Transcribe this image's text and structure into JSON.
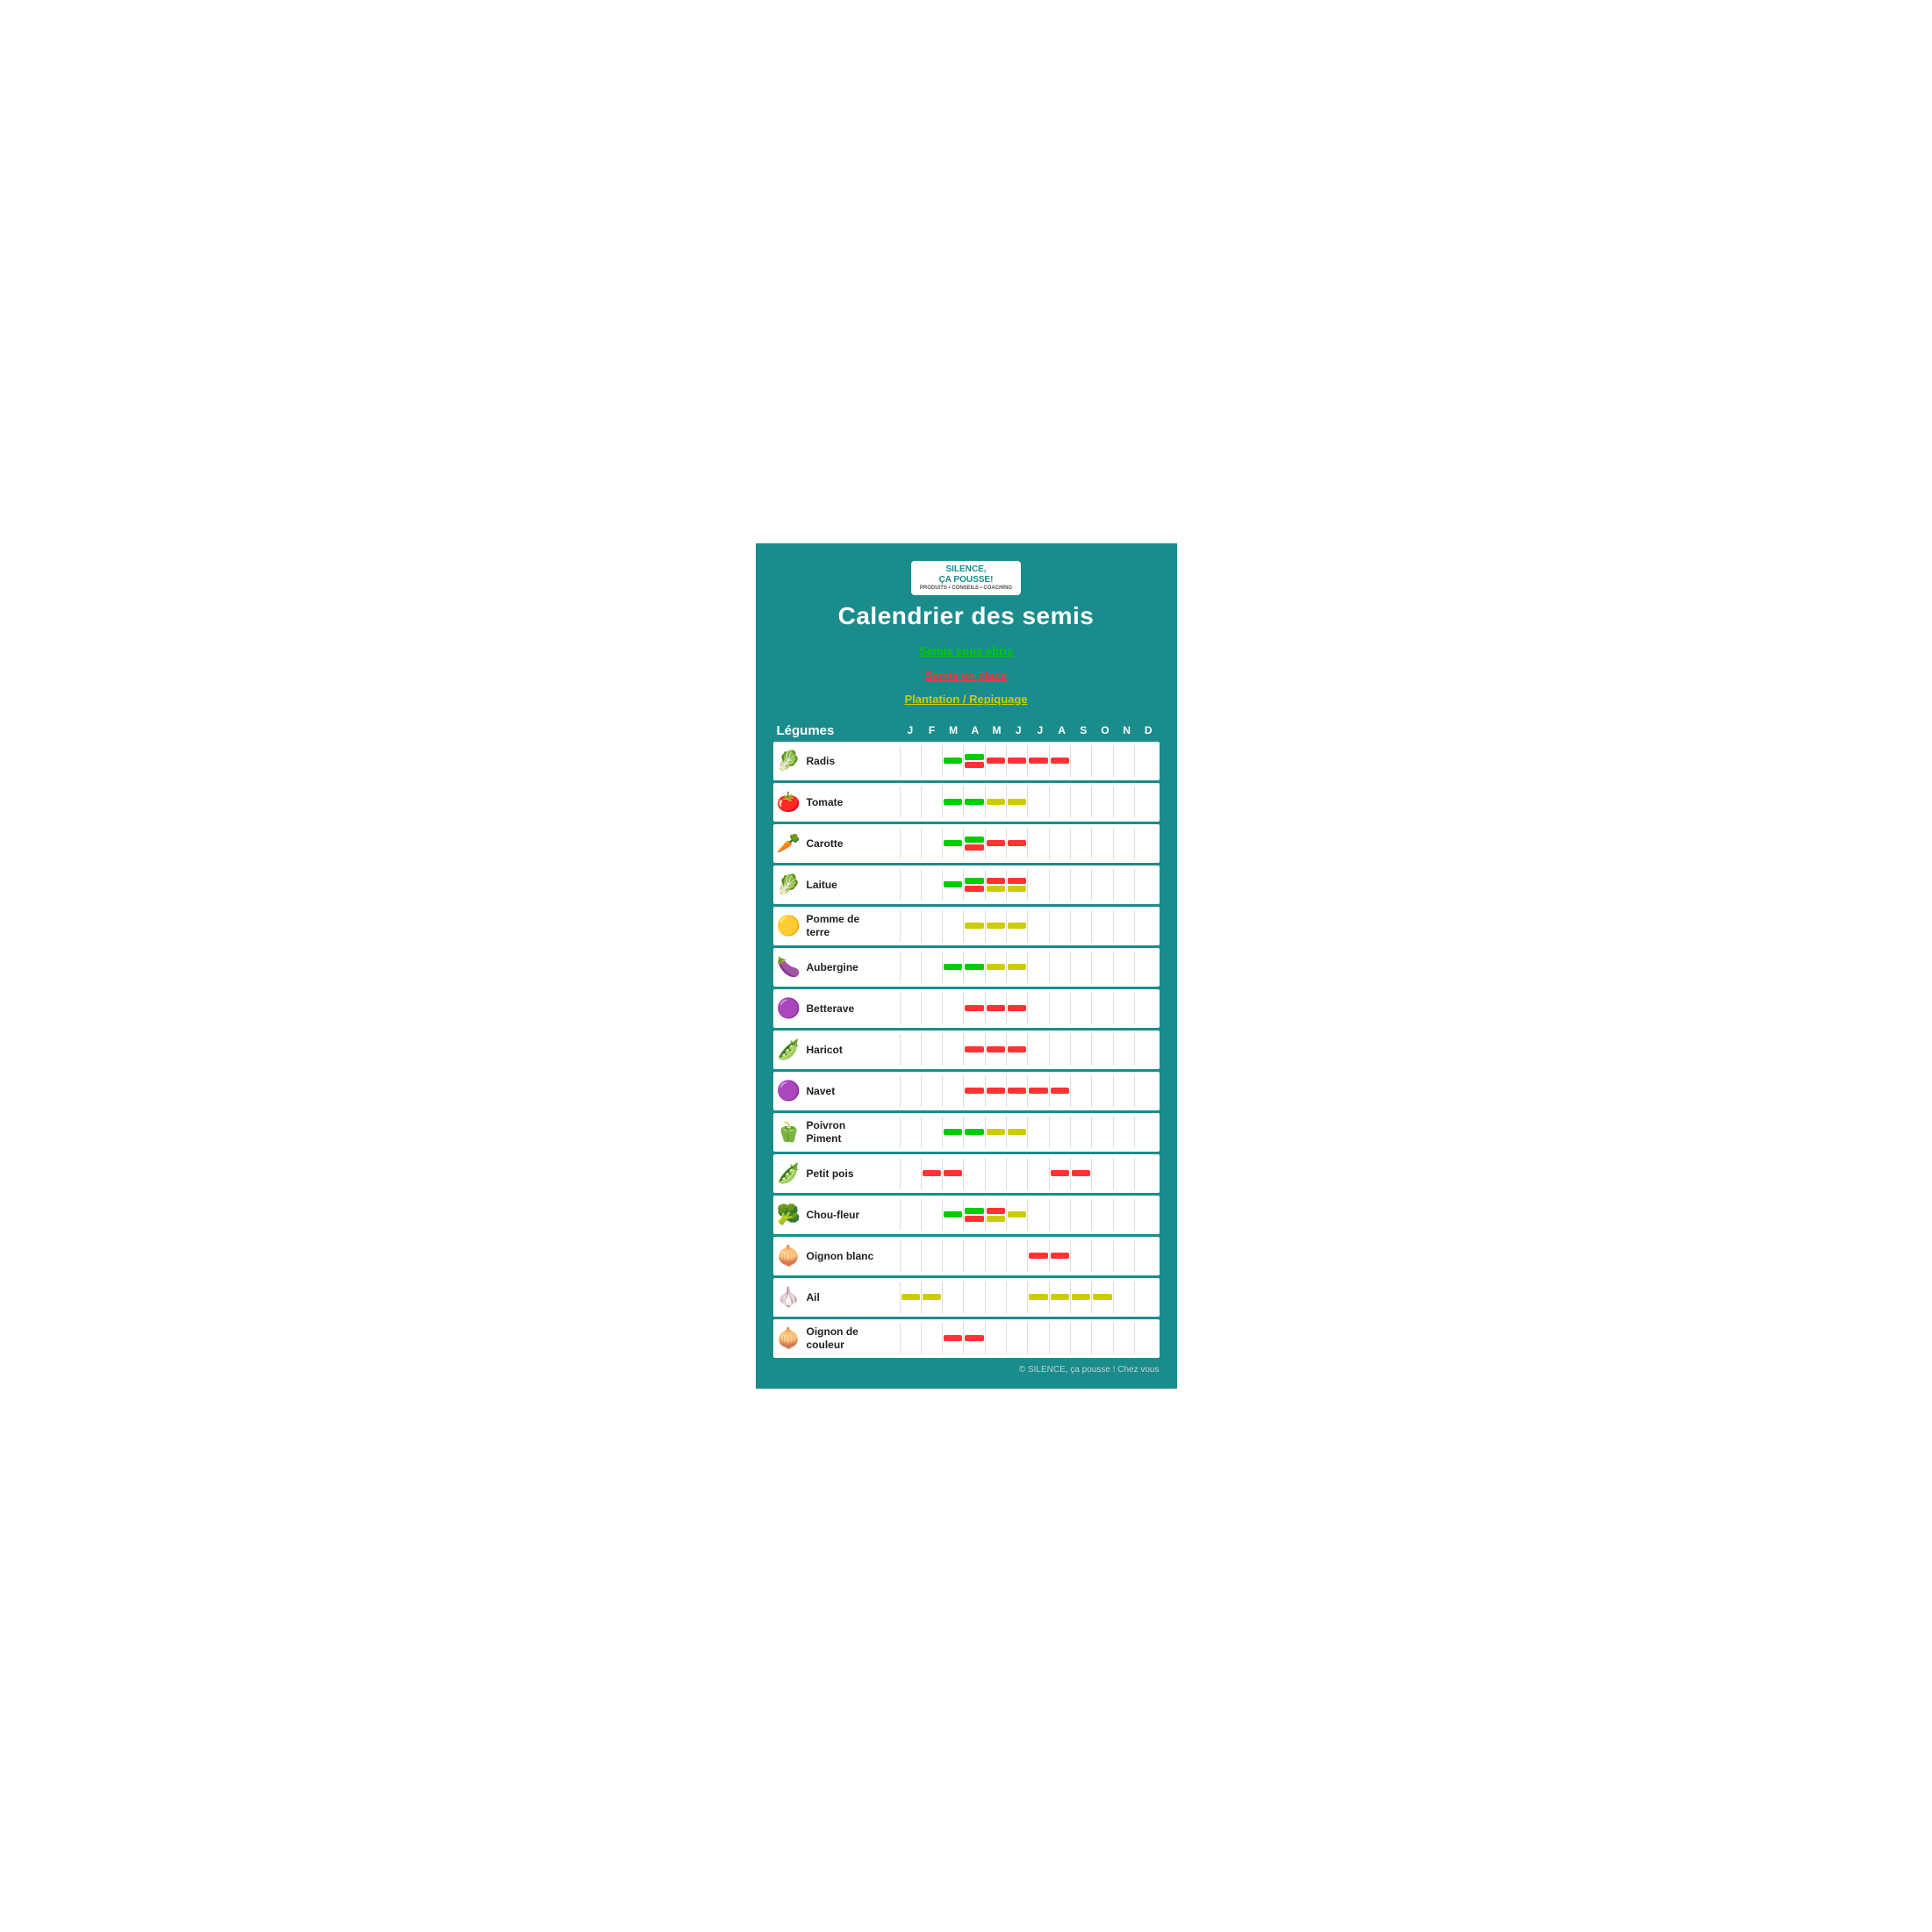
{
  "logo": {
    "line1": "SILENCE,",
    "line2": "ça pousse!",
    "sub": "PRODUITS • CONSEILS • COACHING"
  },
  "title": "Calendrier des semis",
  "legend": [
    {
      "label": "Semis sous abris",
      "color": "green"
    },
    {
      "label": "Semis en place",
      "color": "red"
    },
    {
      "label": "Plantation / Repiquage",
      "color": "yellow"
    }
  ],
  "months": [
    "J",
    "F",
    "M",
    "A",
    "M",
    "J",
    "J",
    "A",
    "S",
    "O",
    "N",
    "D"
  ],
  "col_header": "Légumes",
  "footer": "© SILENCE, ça pousse ! Chez vous",
  "vegetables": [
    {
      "name": "Radis",
      "icon": "🥬",
      "bars": [
        {
          "month": 2,
          "types": [
            "green"
          ]
        },
        {
          "month": 3,
          "types": [
            "green",
            "red"
          ]
        },
        {
          "month": 4,
          "types": [
            "red"
          ]
        },
        {
          "month": 5,
          "types": [
            "red"
          ]
        },
        {
          "month": 6,
          "types": [
            "red"
          ]
        },
        {
          "month": 7,
          "types": [
            "red"
          ]
        }
      ]
    },
    {
      "name": "Tomate",
      "icon": "🍅",
      "bars": [
        {
          "month": 2,
          "types": [
            "green"
          ]
        },
        {
          "month": 3,
          "types": [
            "green"
          ]
        },
        {
          "month": 4,
          "types": [
            "yellow"
          ]
        },
        {
          "month": 5,
          "types": [
            "yellow"
          ]
        }
      ]
    },
    {
      "name": "Carotte",
      "icon": "🥕",
      "bars": [
        {
          "month": 2,
          "types": [
            "green"
          ]
        },
        {
          "month": 3,
          "types": [
            "green",
            "red"
          ]
        },
        {
          "month": 4,
          "types": [
            "red"
          ]
        },
        {
          "month": 5,
          "types": [
            "red"
          ]
        }
      ]
    },
    {
      "name": "Laitue",
      "icon": "🥬",
      "bars": [
        {
          "month": 2,
          "types": [
            "green"
          ]
        },
        {
          "month": 3,
          "types": [
            "green",
            "red"
          ]
        },
        {
          "month": 4,
          "types": [
            "red",
            "yellow"
          ]
        },
        {
          "month": 5,
          "types": [
            "red",
            "yellow"
          ]
        }
      ]
    },
    {
      "name": "Pomme de\nterre",
      "icon": "🟡",
      "bars": [
        {
          "month": 3,
          "types": [
            "yellow"
          ]
        },
        {
          "month": 4,
          "types": [
            "yellow"
          ]
        },
        {
          "month": 5,
          "types": [
            "yellow"
          ]
        }
      ]
    },
    {
      "name": "Aubergine",
      "icon": "🍆",
      "bars": [
        {
          "month": 2,
          "types": [
            "green"
          ]
        },
        {
          "month": 3,
          "types": [
            "green"
          ]
        },
        {
          "month": 4,
          "types": [
            "yellow"
          ]
        },
        {
          "month": 5,
          "types": [
            "yellow"
          ]
        }
      ]
    },
    {
      "name": "Betterave",
      "icon": "🟣",
      "bars": [
        {
          "month": 3,
          "types": [
            "red"
          ]
        },
        {
          "month": 4,
          "types": [
            "red"
          ]
        },
        {
          "month": 5,
          "types": [
            "red"
          ]
        }
      ]
    },
    {
      "name": "Haricot",
      "icon": "🫛",
      "bars": [
        {
          "month": 3,
          "types": [
            "red"
          ]
        },
        {
          "month": 4,
          "types": [
            "red"
          ]
        },
        {
          "month": 5,
          "types": [
            "red"
          ]
        }
      ]
    },
    {
      "name": "Navet",
      "icon": "🟣",
      "bars": [
        {
          "month": 3,
          "types": [
            "red"
          ]
        },
        {
          "month": 4,
          "types": [
            "red"
          ]
        },
        {
          "month": 5,
          "types": [
            "red"
          ]
        },
        {
          "month": 6,
          "types": [
            "red"
          ]
        },
        {
          "month": 7,
          "types": [
            "red"
          ]
        }
      ]
    },
    {
      "name": "Poivron\nPiment",
      "icon": "🫑",
      "bars": [
        {
          "month": 2,
          "types": [
            "green"
          ]
        },
        {
          "month": 3,
          "types": [
            "green"
          ]
        },
        {
          "month": 4,
          "types": [
            "yellow"
          ]
        },
        {
          "month": 5,
          "types": [
            "yellow"
          ]
        }
      ]
    },
    {
      "name": "Petit pois",
      "icon": "🫛",
      "bars": [
        {
          "month": 1,
          "types": [
            "red"
          ]
        },
        {
          "month": 2,
          "types": [
            "red"
          ]
        },
        {
          "month": 7,
          "types": [
            "red"
          ]
        },
        {
          "month": 8,
          "types": [
            "red"
          ]
        }
      ]
    },
    {
      "name": "Chou-fleur",
      "icon": "🥦",
      "bars": [
        {
          "month": 2,
          "types": [
            "green"
          ]
        },
        {
          "month": 3,
          "types": [
            "green",
            "red"
          ]
        },
        {
          "month": 4,
          "types": [
            "red",
            "yellow"
          ]
        },
        {
          "month": 5,
          "types": [
            "yellow"
          ]
        }
      ]
    },
    {
      "name": "Oignon blanc",
      "icon": "🧅",
      "bars": [
        {
          "month": 6,
          "types": [
            "red"
          ]
        },
        {
          "month": 7,
          "types": [
            "red"
          ]
        }
      ]
    },
    {
      "name": "Ail",
      "icon": "🧄",
      "bars": [
        {
          "month": 0,
          "types": [
            "yellow"
          ]
        },
        {
          "month": 1,
          "types": [
            "yellow"
          ]
        },
        {
          "month": 6,
          "types": [
            "yellow"
          ]
        },
        {
          "month": 7,
          "types": [
            "yellow"
          ]
        },
        {
          "month": 8,
          "types": [
            "yellow"
          ]
        },
        {
          "month": 9,
          "types": [
            "yellow"
          ]
        }
      ]
    },
    {
      "name": "Oignon de\ncouleur",
      "icon": "🧅",
      "bars": [
        {
          "month": 2,
          "types": [
            "red"
          ]
        },
        {
          "month": 3,
          "types": [
            "red"
          ]
        }
      ]
    }
  ]
}
